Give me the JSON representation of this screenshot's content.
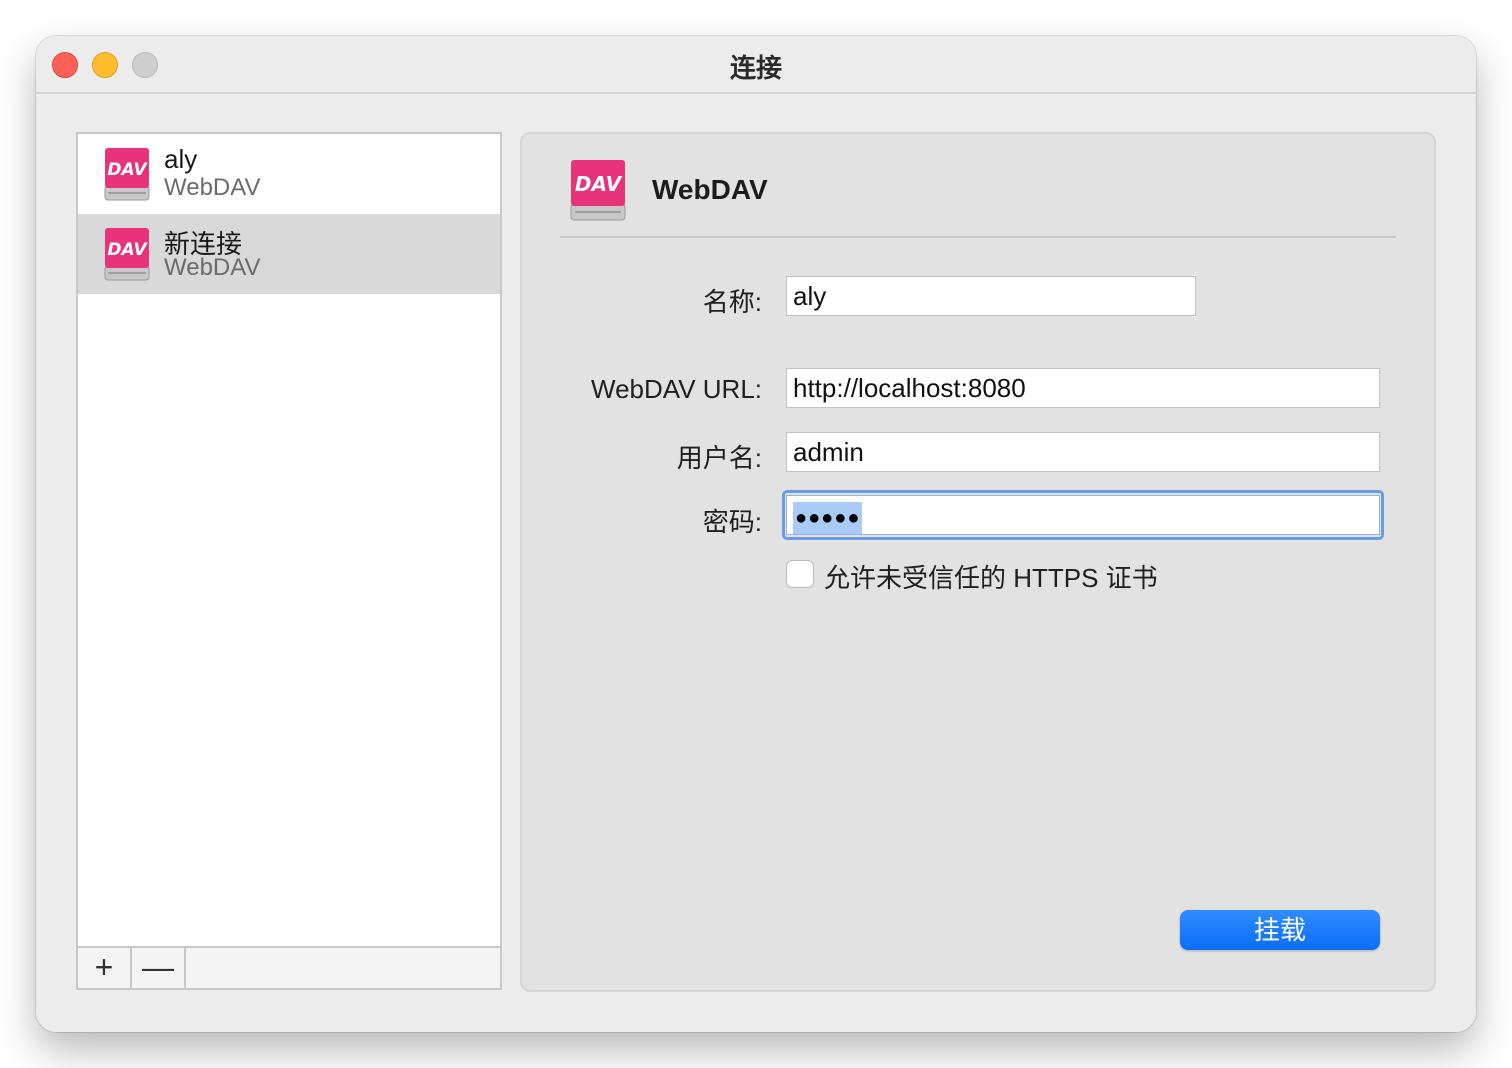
{
  "window": {
    "title": "连接"
  },
  "sidebar": {
    "connections": [
      {
        "name": "aly",
        "type": "WebDAV",
        "icon": "webdav-drive-icon"
      },
      {
        "name": "新连接",
        "type": "WebDAV",
        "icon": "webdav-drive-icon"
      }
    ],
    "selected_index": 1,
    "add_label": "+",
    "remove_label": "—"
  },
  "panel": {
    "title": "WebDAV",
    "icon": "webdav-drive-icon",
    "fields": {
      "name": {
        "label": "名称:",
        "value": "aly"
      },
      "url": {
        "label": "WebDAV URL:",
        "value": "http://localhost:8080"
      },
      "username": {
        "label": "用户名:",
        "value": "admin"
      },
      "password": {
        "label": "密码:",
        "masked_value": "●●●●●"
      }
    },
    "allow_untrusted_https": {
      "label": "允许未受信任的 HTTPS 证书",
      "checked": false
    },
    "mount_button": "挂载"
  },
  "colors": {
    "accent": "#0a6ef5",
    "dav_icon": "#e8337a",
    "close": "#fe5f57",
    "minimize": "#febc2e",
    "zoom": "#cfcfcf"
  }
}
